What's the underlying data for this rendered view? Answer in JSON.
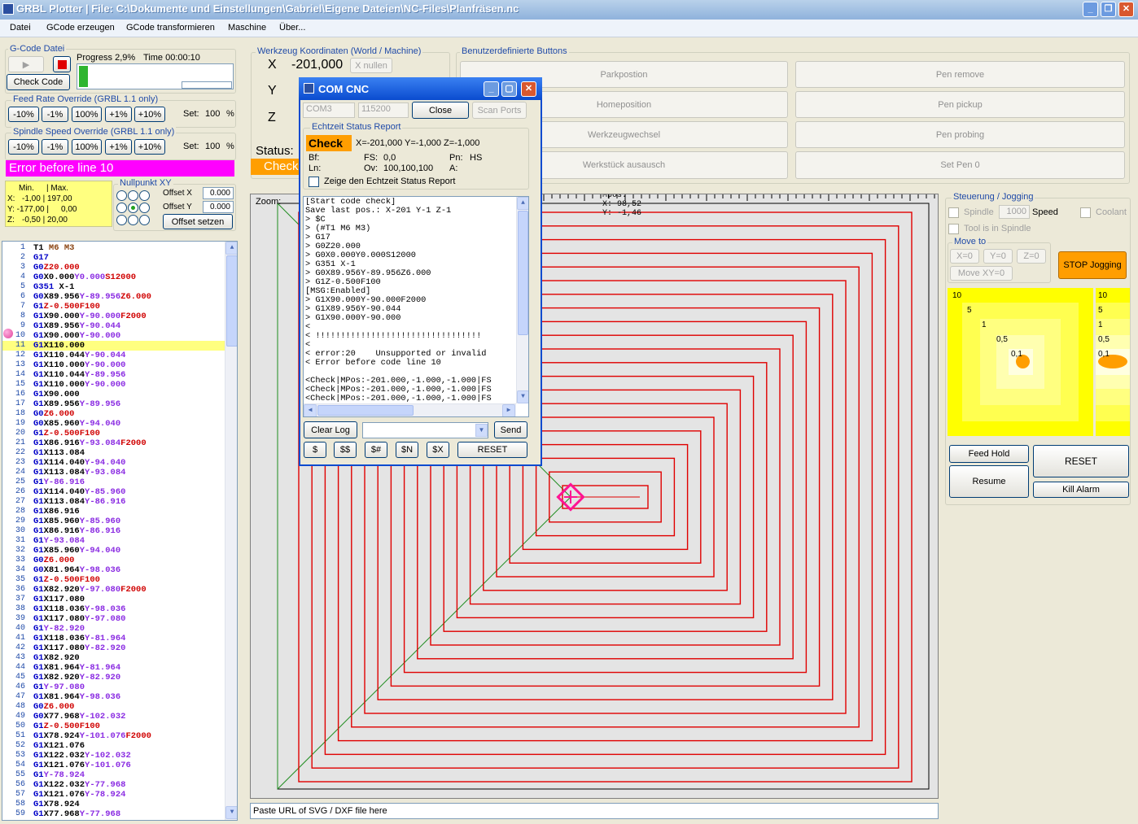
{
  "window": {
    "title": "GRBL Plotter  |  File: C:\\Dokumente und Einstellungen\\Gabriel\\Eigene Dateien\\NC-Files\\Planfräsen.nc"
  },
  "menu": [
    "Datei",
    "GCode erzeugen",
    "GCode transformieren",
    "Maschine",
    "Über..."
  ],
  "gcode_file": {
    "legend": "G-Code Datei",
    "check_code": "Check Code",
    "progress_label": "Progress 2,9%",
    "time_label": "Time 00:00:10",
    "progress": 0.029
  },
  "feed_override": {
    "legend": "Feed Rate Override (GRBL 1.1 only)",
    "buttons": [
      "-10%",
      "-1%",
      "100%",
      "+1%",
      "+10%"
    ],
    "set_label": "Set:",
    "value": "100",
    "unit": "%"
  },
  "spindle_override": {
    "legend": "Spindle Speed Override (GRBL 1.1 only)",
    "buttons": [
      "-10%",
      "-1%",
      "100%",
      "+1%",
      "+10%"
    ],
    "set_label": "Set:",
    "value": "100",
    "unit": "%"
  },
  "error_banner": "Error before line 10",
  "dimensions": {
    "header_min": "Min.",
    "header_max": "| Max.",
    "x_label": "X:",
    "x_values": "-1,00 |  197,00",
    "y_label": "Y: -177,00 |",
    "y_max": "0,00",
    "z_label": "Z:",
    "z_values": "-0,50 |   20,00"
  },
  "nullpunkt": {
    "legend": "Nullpunkt XY",
    "offset_x_label": "Offset X",
    "offset_x": "0.000",
    "offset_y_label": "Offset Y",
    "offset_y": "0.000",
    "set_button": "Offset setzen"
  },
  "coordinates": {
    "legend": "Werkzeug Koordinaten (World / Machine)",
    "x_axis": "X",
    "y_axis": "Y",
    "z_axis": "Z",
    "x_value": "-201,000",
    "x_null": "X nullen",
    "status_label": "Status:",
    "status_value": "Check"
  },
  "custom_buttons": {
    "legend": "Benutzerdefinierte Buttons",
    "left": [
      "Parkpostion",
      "Homeposition",
      "Werkzeugwechsel",
      "Werkstück ausausch"
    ],
    "right": [
      "Pen remove",
      "Pen pickup",
      "Pen probing",
      "Set Pen 0"
    ]
  },
  "code_lines": [
    {
      "n": "1",
      "t": "T1 M6 M3"
    },
    {
      "n": "2",
      "t": "G17"
    },
    {
      "n": "3",
      "t": "G0Z20.000"
    },
    {
      "n": "4",
      "t": "G0X0.000Y0.000S12000"
    },
    {
      "n": "5",
      "t": "G351 X-1"
    },
    {
      "n": "6",
      "t": "G0X89.956Y-89.956Z6.000"
    },
    {
      "n": "7",
      "t": "G1Z-0.500F100"
    },
    {
      "n": "8",
      "t": "G1X90.000Y-90.000F2000"
    },
    {
      "n": "9",
      "t": "G1X89.956Y-90.044"
    },
    {
      "n": "10",
      "t": "G1X90.000Y-90.000"
    },
    {
      "n": "11",
      "t": "G1X110.000"
    },
    {
      "n": "12",
      "t": "G1X110.044Y-90.044"
    },
    {
      "n": "13",
      "t": "G1X110.000Y-90.000"
    },
    {
      "n": "14",
      "t": "G1X110.044Y-89.956"
    },
    {
      "n": "15",
      "t": "G1X110.000Y-90.000"
    },
    {
      "n": "16",
      "t": "G1X90.000"
    },
    {
      "n": "17",
      "t": "G1X89.956Y-89.956"
    },
    {
      "n": "18",
      "t": "G0Z6.000"
    },
    {
      "n": "19",
      "t": "G0X85.960Y-94.040"
    },
    {
      "n": "20",
      "t": "G1Z-0.500F100"
    },
    {
      "n": "21",
      "t": "G1X86.916Y-93.084F2000"
    },
    {
      "n": "22",
      "t": "G1X113.084"
    },
    {
      "n": "23",
      "t": "G1X114.040Y-94.040"
    },
    {
      "n": "24",
      "t": "G1X113.084Y-93.084"
    },
    {
      "n": "25",
      "t": "G1Y-86.916"
    },
    {
      "n": "26",
      "t": "G1X114.040Y-85.960"
    },
    {
      "n": "27",
      "t": "G1X113.084Y-86.916"
    },
    {
      "n": "28",
      "t": "G1X86.916"
    },
    {
      "n": "29",
      "t": "G1X85.960Y-85.960"
    },
    {
      "n": "30",
      "t": "G1X86.916Y-86.916"
    },
    {
      "n": "31",
      "t": "G1Y-93.084"
    },
    {
      "n": "32",
      "t": "G1X85.960Y-94.040"
    },
    {
      "n": "33",
      "t": "G0Z6.000"
    },
    {
      "n": "34",
      "t": "G0X81.964Y-98.036"
    },
    {
      "n": "35",
      "t": "G1Z-0.500F100"
    },
    {
      "n": "36",
      "t": "G1X82.920Y-97.080F2000"
    },
    {
      "n": "37",
      "t": "G1X117.080"
    },
    {
      "n": "38",
      "t": "G1X118.036Y-98.036"
    },
    {
      "n": "39",
      "t": "G1X117.080Y-97.080"
    },
    {
      "n": "40",
      "t": "G1Y-82.920"
    },
    {
      "n": "41",
      "t": "G1X118.036Y-81.964"
    },
    {
      "n": "42",
      "t": "G1X117.080Y-82.920"
    },
    {
      "n": "43",
      "t": "G1X82.920"
    },
    {
      "n": "44",
      "t": "G1X81.964Y-81.964"
    },
    {
      "n": "45",
      "t": "G1X82.920Y-82.920"
    },
    {
      "n": "46",
      "t": "G1Y-97.080"
    },
    {
      "n": "47",
      "t": "G1X81.964Y-98.036"
    },
    {
      "n": "48",
      "t": "G0Z6.000"
    },
    {
      "n": "49",
      "t": "G0X77.968Y-102.032"
    },
    {
      "n": "50",
      "t": "G1Z-0.500F100"
    },
    {
      "n": "51",
      "t": "G1X78.924Y-101.076F2000"
    },
    {
      "n": "52",
      "t": "G1X121.076"
    },
    {
      "n": "53",
      "t": "G1X122.032Y-102.032"
    },
    {
      "n": "54",
      "t": "G1X121.076Y-101.076"
    },
    {
      "n": "55",
      "t": "G1Y-78.924"
    },
    {
      "n": "56",
      "t": "G1X122.032Y-77.968"
    },
    {
      "n": "57",
      "t": "G1X121.076Y-78.924"
    },
    {
      "n": "58",
      "t": "G1X78.924"
    },
    {
      "n": "59",
      "t": "G1X77.968Y-77.968"
    }
  ],
  "plot": {
    "zoom_label": "Zoom:",
    "machine_pos_label": "Mpos:",
    "x_readout": "X:   98,52",
    "y_readout": "Y:   -1,46",
    "url_placeholder": "Paste URL of SVG / DXF file here",
    "path_color": "#e00000",
    "marker_color": "#ff1493",
    "diag_color": "#1e8c1e"
  },
  "com_dialog": {
    "title": "COM CNC",
    "port": "COM3",
    "baud": "115200",
    "close": "Close",
    "scan_ports": "Scan Ports",
    "status_legend": "Echtzeit Status Report",
    "status_state": "Check",
    "status_pos": "X=-201,000 Y=-1,000 Z=-1,000",
    "bf_label": "Bf:",
    "fs_label": "FS:",
    "fs_value": "0,0",
    "pn_label": "Pn:",
    "pn_value": "HS",
    "ln_label": "Ln:",
    "ov_label": "Ov:",
    "ov_value": "100,100,100",
    "a_label": "A:",
    "report_checkbox": "Zeige den Echtzeit Status Report",
    "log": "[Start code check]\nSave last pos.: X-201 Y-1 Z-1\n> $C\n> (#T1 M6 M3)\n> G17\n> G0Z20.000\n> G0X0.000Y0.000S12000\n> G351 X-1\n> G0X89.956Y-89.956Z6.000\n> G1Z-0.500F100\n[MSG:Enabled]\n> G1X90.000Y-90.000F2000\n> G1X89.956Y-90.044\n> G1X90.000Y-90.000\n<\n< !!!!!!!!!!!!!!!!!!!!!!!!!!!!!!!!!\n<\n< error:20    Unsupported or invalid\n< Error before code line 10\n\n<Check|MPos:-201.000,-1.000,-1.000|FS\n<Check|MPos:-201.000,-1.000,-1.000|FS\n<Check|MPos:-201.000,-1.000,-1.000|FS",
    "clear_log": "Clear Log",
    "send": "Send",
    "cmd_buttons": [
      "$",
      "$$",
      "$#",
      "$N",
      "$X"
    ],
    "reset": "RESET"
  },
  "jogging": {
    "legend": "Steuerung / Jogging",
    "spindle_label": "Spindle",
    "speed_value": "1000",
    "speed_label": "Speed",
    "coolant_label": "Coolant",
    "tool_label": "Tool is in Spindle",
    "move_to_legend": "Move to",
    "x0": "X=0",
    "y0": "Y=0",
    "z0": "Z=0",
    "move_xy0": "Move XY=0",
    "stop_jogging": "STOP Jogging",
    "xy_labels": [
      "10",
      "5",
      "1",
      "0,5",
      "0,1"
    ],
    "z_labels": [
      "10",
      "5",
      "1",
      "0,5",
      "0,1"
    ],
    "feed_hold": "Feed Hold",
    "resume": "Resume",
    "reset": "RESET",
    "kill_alarm": "Kill Alarm"
  }
}
